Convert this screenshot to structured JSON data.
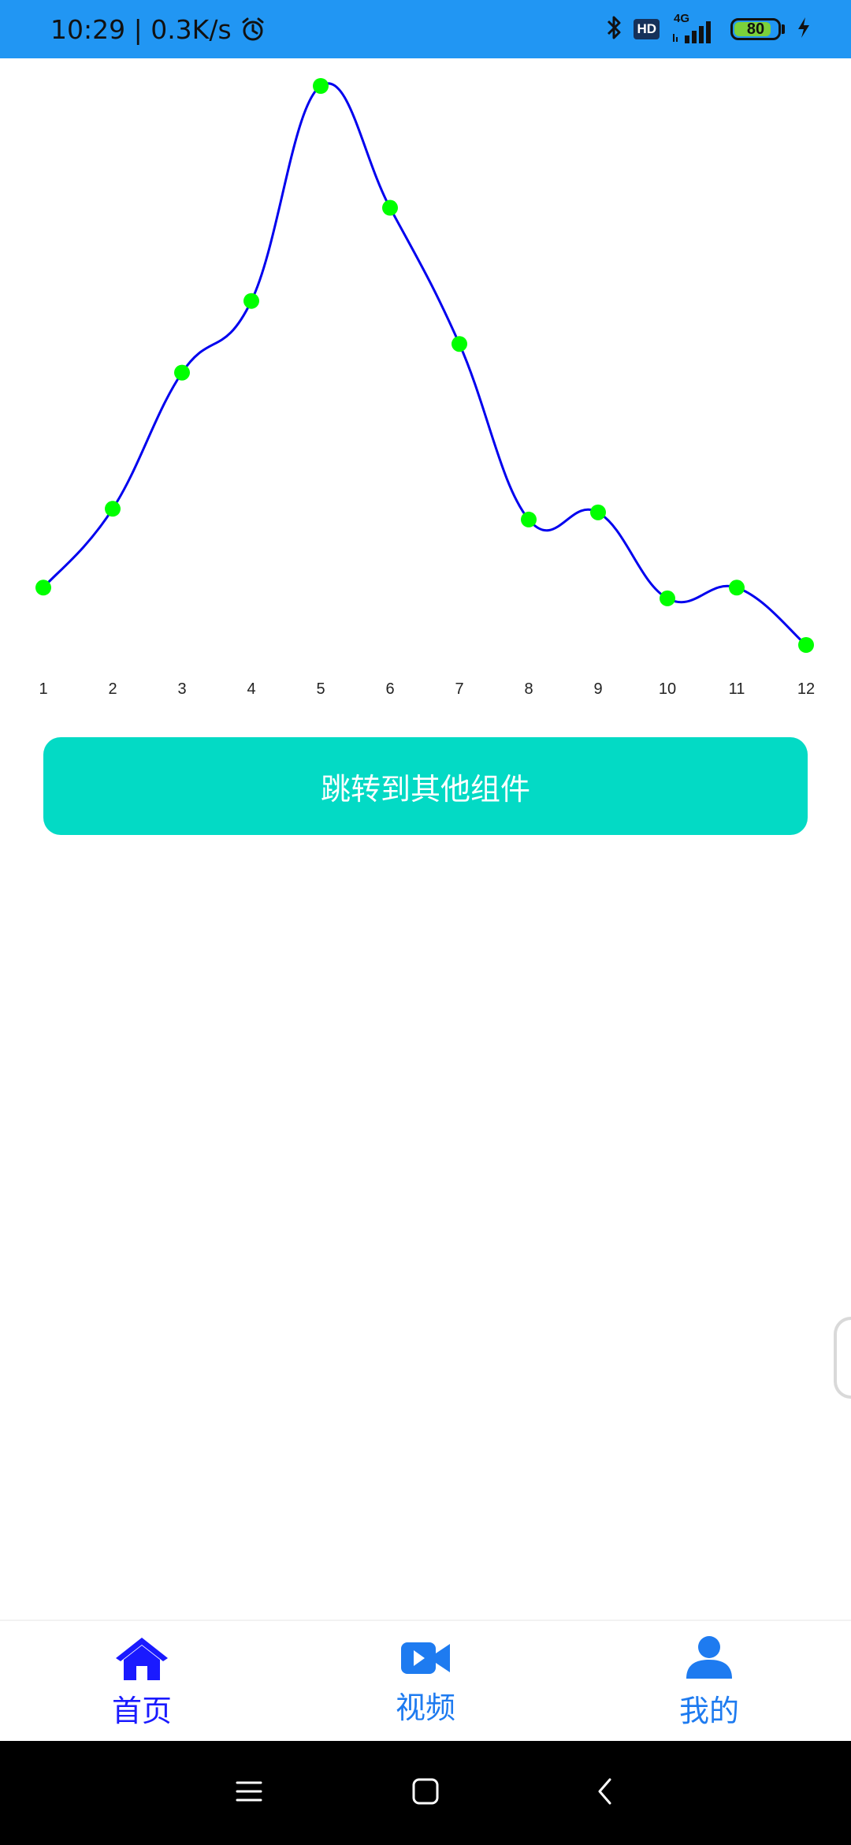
{
  "status_bar": {
    "time_speed": "10:29 | 0.3K/s",
    "hd_label": "HD",
    "network_label": "4G",
    "battery_level": "80",
    "background_color": "#2196f3",
    "icons": [
      "alarm-icon",
      "bluetooth-icon",
      "signal-icon",
      "battery-icon",
      "charging-icon"
    ]
  },
  "chart_data": {
    "type": "line",
    "x": [
      1,
      2,
      3,
      4,
      5,
      6,
      7,
      8,
      9,
      10,
      11,
      12
    ],
    "tick_labels": [
      "1",
      "2",
      "3",
      "4",
      "5",
      "6",
      "7",
      "8",
      "9",
      "10",
      "11",
      "12"
    ],
    "series": [
      {
        "values": [
          8,
          19,
          38,
          48,
          78,
          61,
          42,
          17.5,
          18.5,
          6.5,
          8,
          0
        ],
        "line_color": "#0000ee",
        "marker_color": "#00ff00",
        "smooth": true
      }
    ],
    "y_axis_visible": false,
    "grid": false,
    "ylim": [
      0,
      78
    ]
  },
  "action_button": {
    "label": "跳转到其他组件",
    "color": "#03dac5"
  },
  "bottom_nav": {
    "items": [
      {
        "label": "首页",
        "icon": "home-icon",
        "color": "#1a1aff",
        "active": true
      },
      {
        "label": "视频",
        "icon": "video-icon",
        "color": "#1e7bf0",
        "active": false
      },
      {
        "label": "我的",
        "icon": "person-icon",
        "color": "#1e7bf0",
        "active": false
      }
    ]
  },
  "system_nav": {
    "icons": [
      "menu-icon",
      "home-square-icon",
      "back-icon"
    ]
  }
}
